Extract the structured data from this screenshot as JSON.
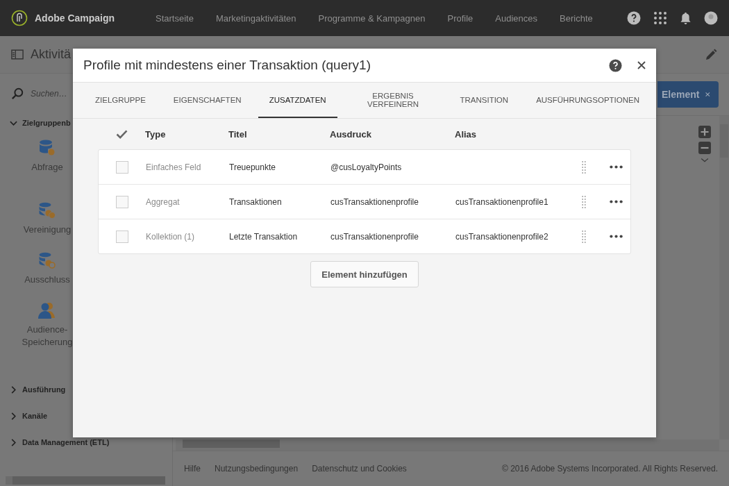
{
  "app": {
    "name": "Adobe Campaign",
    "nav": [
      "Startseite",
      "Marketingaktivitäten",
      "Programme & Kampagnen",
      "Profile",
      "Audiences",
      "Berichte"
    ]
  },
  "header": {
    "title": "Aktivitä"
  },
  "sidebar": {
    "search": {
      "placeholder": "Suchen…"
    },
    "groups": [
      {
        "label": "Zielgruppenb",
        "expanded": true,
        "items": [
          {
            "label": "Abfrage",
            "kind": "query"
          },
          {
            "label": "Vereinigung",
            "kind": "union"
          },
          {
            "label": "Ausschluss",
            "kind": "exclusion"
          },
          {
            "label": "Audience-Speicherung",
            "kind": "audience"
          }
        ]
      },
      {
        "label": "Ausführung",
        "expanded": false
      },
      {
        "label": "Kanäle",
        "expanded": false
      },
      {
        "label": "Data Management (ETL)",
        "expanded": false
      }
    ]
  },
  "canvas": {
    "element_button": "Element"
  },
  "footer": {
    "links": [
      "Hilfe",
      "Nutzungsbedingungen",
      "Datenschutz und Cookies"
    ],
    "copyright": "© 2016 Adobe Systems Incorporated. All Rights Reserved."
  },
  "dialog": {
    "title": "Profile mit mindestens einer Transaktion (query1)",
    "tabs": [
      {
        "label": "ZIELGRUPPE",
        "selected": false
      },
      {
        "label": "EIGENSCHAFTEN",
        "selected": false
      },
      {
        "label": "ZUSATZDATEN",
        "selected": true
      },
      {
        "label": "ERGEBNIS VERFEINERN",
        "selected": false
      },
      {
        "label": "TRANSITION",
        "selected": false
      },
      {
        "label": "AUSFÜHRUNGSOPTIONEN",
        "selected": false
      }
    ],
    "columns": [
      "Type",
      "Titel",
      "Ausdruck",
      "Alias"
    ],
    "rows": [
      {
        "checked": false,
        "type": "Einfaches Feld",
        "title": "Treuepunkte",
        "expression": "@cusLoyaltyPoints"
      },
      {
        "checked": false,
        "type": "Aggregat",
        "title": "Transaktionen",
        "expression": "cusTransaktionenprofile",
        "alias": "cusTransaktionenprofile1"
      },
      {
        "checked": false,
        "type": "Kollektion (1)",
        "title": "Letzte Transaktion",
        "expression": "cusTransaktionenprofile",
        "alias": "cusTransaktionenprofile2"
      }
    ],
    "add_button": "Element hinzufügen"
  }
}
